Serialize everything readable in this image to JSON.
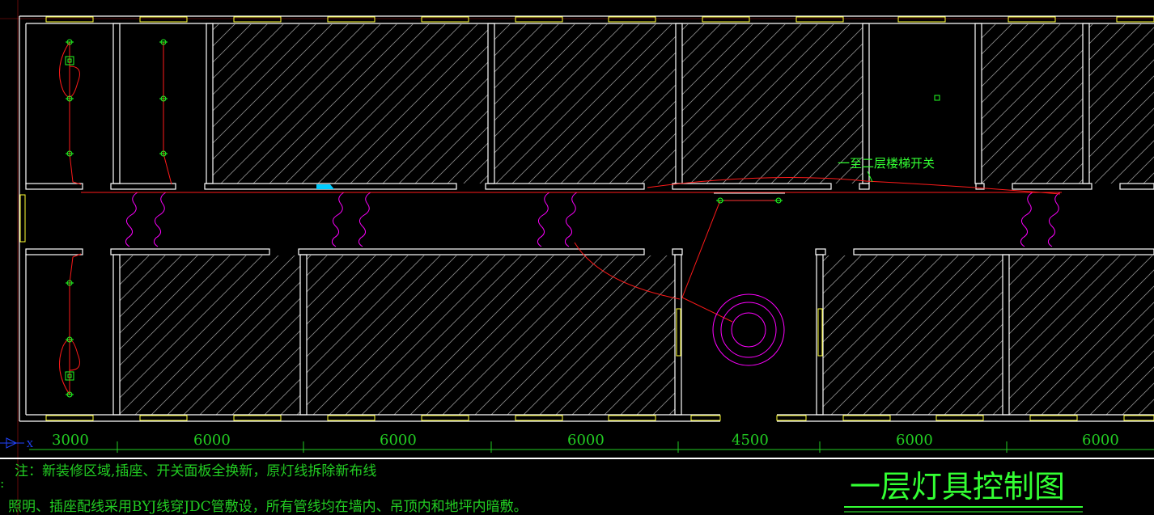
{
  "drawing": {
    "title": "一层灯具控制图",
    "annotation_switch": "一至二层楼梯开关",
    "note_line1": "注：新装修区域,插座、开关面板全换新，原灯线拆除新布线",
    "note_line2": "照明、插座配线采用BYJ线穿JDC管敷设，所有管线均在墙内、吊顶内和地坪内暗敷。",
    "note_colon": ":",
    "axis_x_glyph": "X",
    "dimensions": [
      "3000",
      "6000",
      "6000",
      "6000",
      "4500",
      "6000",
      "6000"
    ]
  },
  "colors": {
    "background": "#000000",
    "walls": "#ffffff",
    "windows": "#ffff33",
    "wiring": "#ff1a1a",
    "doors": "#ff00ff",
    "fixtures": "#22ff22",
    "text": "#22cc22",
    "hatch": "#9a9a9a"
  }
}
